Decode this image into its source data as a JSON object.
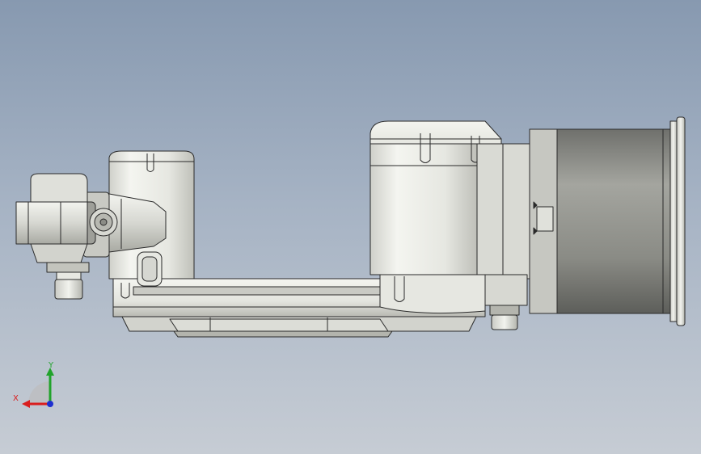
{
  "viewport": {
    "background_top": "#8799b0",
    "background_bottom": "#c6ccd4"
  },
  "model": {
    "body_color": "#e9eae4",
    "shadow_color": "#b9bab3",
    "motor_color": "#8e8e88",
    "edge_color": "#2a2a2a"
  },
  "triad": {
    "x_label": "X",
    "y_label": "Y",
    "x_color": "#d91e1e",
    "y_color": "#21a32b",
    "z_color": "#1d2fd0"
  }
}
